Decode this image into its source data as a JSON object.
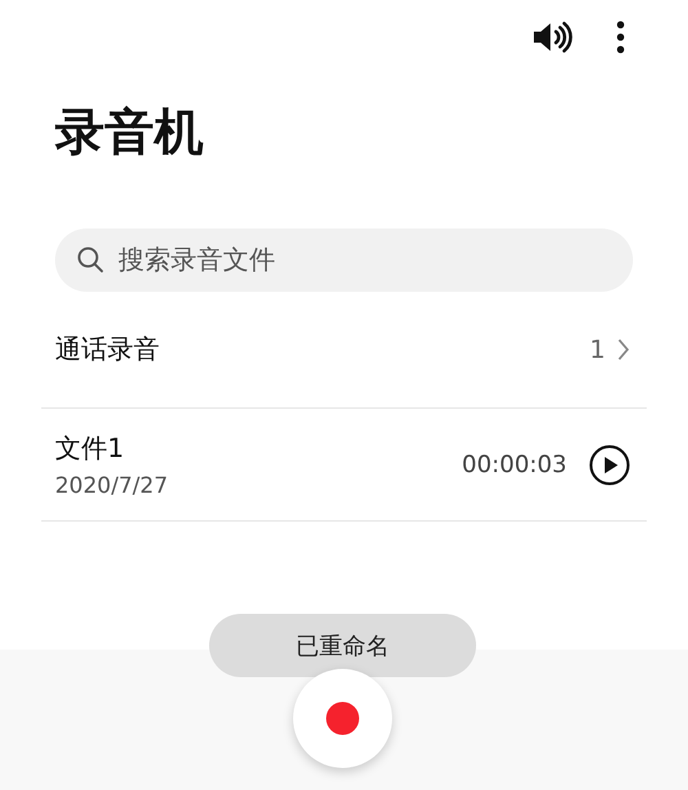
{
  "title": "录音机",
  "search": {
    "placeholder": "搜索录音文件"
  },
  "folder": {
    "name": "通话录音",
    "count": "1"
  },
  "recordings": [
    {
      "name": "文件1",
      "date": "2020/7/27",
      "duration": "00:00:03"
    }
  ],
  "toast": "已重命名"
}
